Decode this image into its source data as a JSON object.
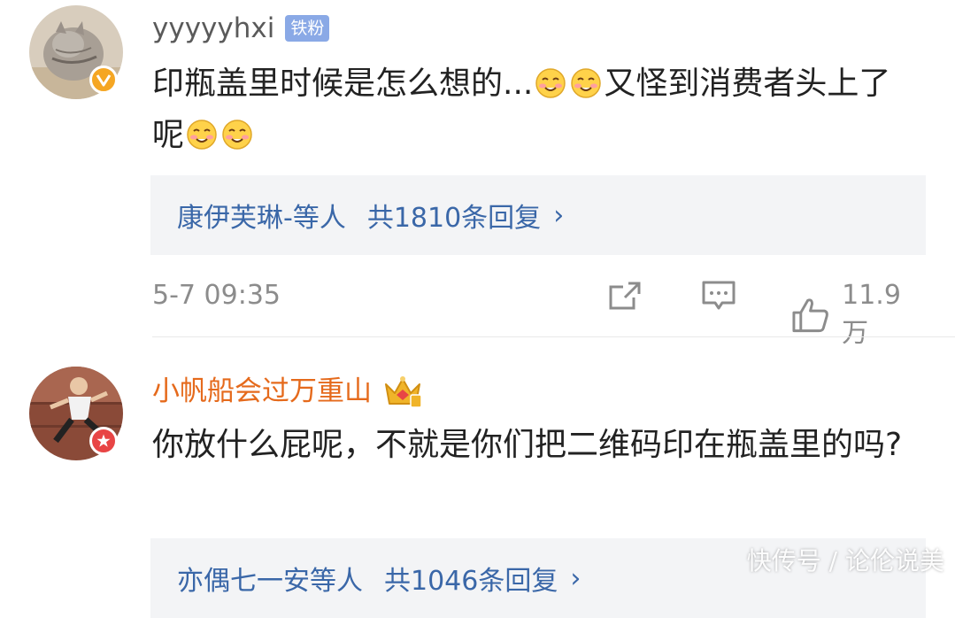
{
  "comments": [
    {
      "username": "yyyyyhxi",
      "fan_badge": "铁粉",
      "content_parts": [
        "印瓶盖里时候是怎么想的...",
        "又怪到消费者头上了呢"
      ],
      "reply_preview": {
        "names": "康伊芙琳",
        "sep": "-等人",
        "count": "共1810条回复",
        "arrow": "›"
      },
      "time": "5-7 09:35",
      "likes": "11.9万"
    },
    {
      "username": "小帆船会过万重山",
      "content": "你放什么屁呢，不就是你们把二维码印在瓶盖里的吗?",
      "reply_preview": {
        "names": "亦偶七一安",
        "sep": "等人",
        "count": "共1046条回复",
        "arrow": "›"
      }
    }
  ],
  "watermark": "快传号 / 论伦说美",
  "icons": {
    "share": "share-icon",
    "comment": "comment-icon",
    "like": "thumbs-up-icon",
    "verified": "verified-v-icon",
    "star": "star-badge-icon",
    "crown": "crown-icon",
    "emoji": "blush-emoji-icon"
  },
  "colors": {
    "username_gray": "#5a5a5a",
    "username_orange": "#e56a1c",
    "link_blue": "#3a67a8",
    "fan_badge_bg": "#8aa9e6",
    "reply_bg": "#f3f4f6",
    "meta_gray": "#8c8c8c"
  }
}
